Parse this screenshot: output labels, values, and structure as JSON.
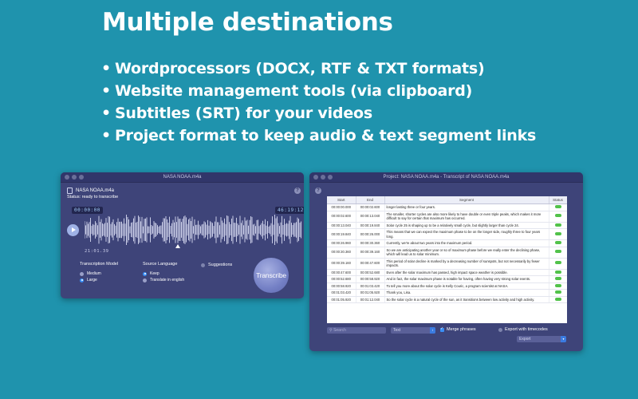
{
  "headline": "Multiple destinations",
  "bullets": [
    "Wordprocessors (DOCX, RTF & TXT formats)",
    "Website management tools (via clipboard)",
    "Subtitles (SRT) for your videos",
    "Project format to keep audio & text segment links"
  ],
  "left_window": {
    "title": "NASA NOAA.m4a",
    "help": "?",
    "file_name": "NASA NOAA.m4a",
    "status": "Status: ready to transcribe",
    "start_time": "00:00:00",
    "end_time": "46:19:12",
    "current_time": "21:01.39",
    "transcription_model": {
      "label": "Transcription Model",
      "options": [
        "Medium",
        "Large"
      ],
      "selected": "Large"
    },
    "source_language": {
      "label": "Source Language",
      "options": [
        "Keep",
        "Translate in english"
      ],
      "selected": "Keep"
    },
    "suggestions_label": "Suggestions",
    "transcribe_label": "Transcribe"
  },
  "right_window": {
    "title": "Project: NASA NOAA.m4a - Transcript of NASA NOAA.m4a",
    "help": "?",
    "columns": [
      "Start",
      "End",
      "Segment",
      "Status"
    ],
    "rows": [
      {
        "start": "00:00:00.000",
        "end": "00:00:02.600",
        "text": "longer lasting three or four years."
      },
      {
        "start": "00:00:02.600",
        "end": "00:00:13.040",
        "text": "The smaller, shorter cycles are also more likely to have double or even triple peaks, which makes it more difficult to say for certain that maximum has occurred."
      },
      {
        "start": "00:00:13.040",
        "end": "00:00:19.840",
        "text": "Solar cycle 25 is shaping up to be a relatively small cycle, but slightly larger than cycle 24."
      },
      {
        "start": "00:00:19.840",
        "end": "00:00:26.000",
        "text": "This means that we can expect the maximum phase to be on the longer side, roughly three to four years long."
      },
      {
        "start": "00:00:26.960",
        "end": "00:00:30.360",
        "text": "Currently, we're about two years into the maximum period."
      },
      {
        "start": "00:00:30.360",
        "end": "00:00:39.160",
        "text": "So we are anticipating another year or so of maximum phase before we really enter the declining phase, which will lead us to solar minimum."
      },
      {
        "start": "00:00:39.160",
        "end": "00:00:47.600",
        "text": "This period of solar decline is marked by a decreasing number of sunspots, but not necessarily by fewer impacts."
      },
      {
        "start": "00:00:47.600",
        "end": "00:00:52.680",
        "text": "Even after the solar maximum has passed, high impact space weather is possible."
      },
      {
        "start": "00:00:52.680",
        "end": "00:00:58.920",
        "text": "And in fact, the solar maximum phase is notable for having, often having very strong solar events."
      },
      {
        "start": "00:00:58.920",
        "end": "00:01:03.420",
        "text": "To tell you more about the solar cycle is Kelly Couric, a program scientist at NASA."
      },
      {
        "start": "00:01:03.420",
        "end": "00:01:05.920",
        "text": "Thank you, Lisa."
      },
      {
        "start": "00:01:05.920",
        "end": "00:01:12.040",
        "text": "So the solar cycle is a natural cycle of the sun, as it transitions between low activity and high activity."
      }
    ],
    "search_placeholder": "Search",
    "filter_value": "Text",
    "merge_phrases_label": "Merge phrases",
    "export_timecodes_label": "Export with timecodes",
    "export_label": "Export"
  },
  "colors": {
    "background": "#1f93ad",
    "window": "#3e4479",
    "status_ok": "#52c24a",
    "accent": "#3b8ff5"
  }
}
